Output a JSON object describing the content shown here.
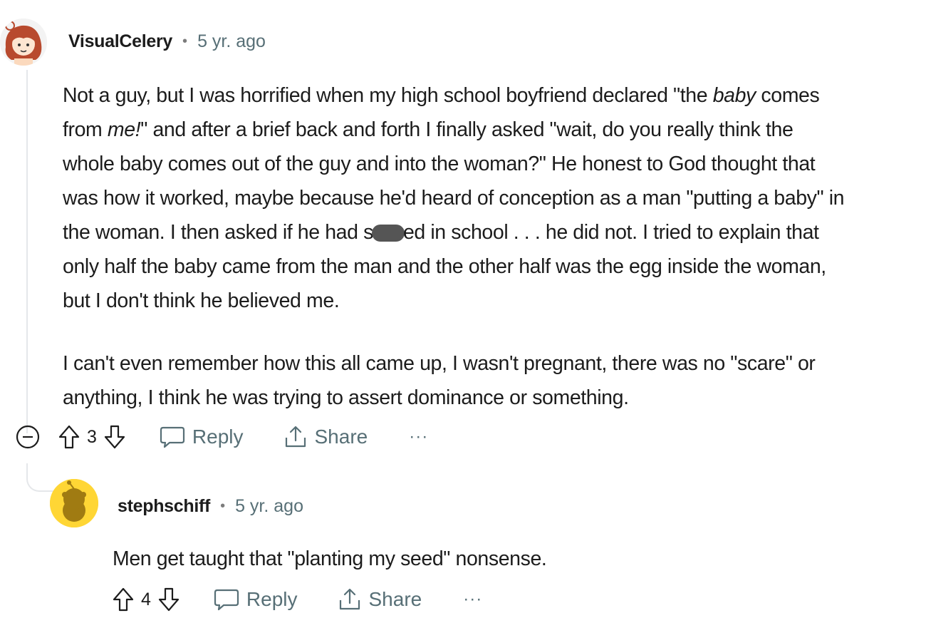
{
  "comment": {
    "username": "VisualCelery",
    "separator": "•",
    "age": "5 yr. ago",
    "paragraph1": {
      "l1_a": "Not a guy, but I was horrified when my high school boyfriend declared \"the ",
      "l1_em": "baby",
      "l1_b": " comes",
      "l2_a": "from ",
      "l2_em": "me!",
      "l2_b": "\" and after a brief back and forth I finally asked \"wait, do you really think the",
      "l3": "whole baby comes out of the guy and into the woman?\" He honest to God thought that",
      "l4": "was how it worked, maybe because he'd heard of conception as a man \"putting a baby\" in",
      "l5_a": "the woman. I then asked if he had s",
      "l5_b": "ed in school . . . he did not. I tried to explain that",
      "l6": "only half the baby came from the man and the other half was the egg inside the woman,",
      "l7": "but I don't think he believed me."
    },
    "paragraph2": {
      "l1": "I can't even remember how this all came up, I wasn't pregnant, there was no \"scare\" or",
      "l2": "anything, I think he was trying to assert dominance or something."
    },
    "vote_count": "3",
    "reply_label": "Reply",
    "share_label": "Share",
    "more_label": "···"
  },
  "reply": {
    "username": "stephschiff",
    "separator": "•",
    "age": "5 yr. ago",
    "text": "Men get taught that \"planting my seed\" nonsense.",
    "vote_count": "4",
    "reply_label": "Reply",
    "share_label": "Share",
    "more_label": "···"
  },
  "icons": {
    "collapse": "minus-circle-icon",
    "upvote": "arrow-up-icon",
    "downvote": "arrow-down-icon",
    "reply": "speech-bubble-icon",
    "share": "share-icon",
    "avatar1": "girl-avatar",
    "avatar2": "snoo-avatar"
  },
  "colors": {
    "text": "#1c1c1c",
    "muted": "#576f76",
    "thread_line": "#e5e7ea",
    "avatar2_bg": "#ffd635"
  }
}
